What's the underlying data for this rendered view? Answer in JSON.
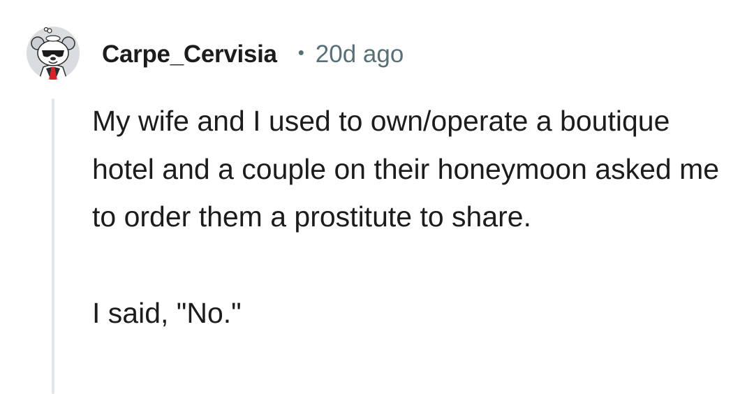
{
  "comment": {
    "username": "Carpe_Cervisia",
    "separator": "•",
    "timestamp": "20d ago",
    "avatar_icon": "snoo-avatar-icon",
    "paragraphs": [
      "My wife and I used to own/operate a boutique hotel and a couple on their honeymoon asked me to order them a prostitute to share.",
      "I said, \"No.\""
    ]
  },
  "colors": {
    "text": "#1c1c1c",
    "meta": "#576f76",
    "thread_line": "#e3e6e8"
  }
}
